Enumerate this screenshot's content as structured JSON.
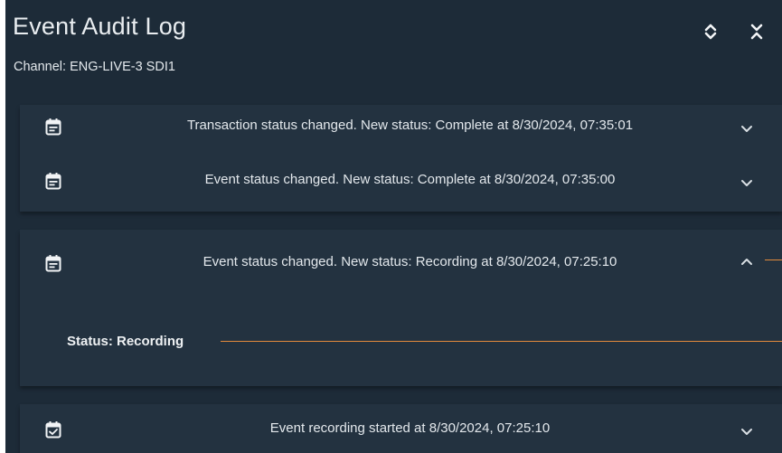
{
  "header": {
    "title": "Event Audit Log",
    "channel": "Channel: ENG-LIVE-3 SDI1",
    "expand_all_icon": "unfold-more-icon",
    "collapse_all_icon": "unfold-less-icon"
  },
  "entries": [
    {
      "icon": "calendar-text-icon",
      "text": "Transaction status changed. New status: Complete at 8/30/2024, 07:35:01",
      "expanded": false
    },
    {
      "icon": "calendar-text-icon",
      "text": "Event status changed. New status: Complete at 8/30/2024, 07:35:00",
      "expanded": false
    },
    {
      "icon": "calendar-text-icon",
      "text": "Event status changed. New status: Recording at 8/30/2024, 07:25:10",
      "expanded": true,
      "detail": "Status: Recording"
    },
    {
      "icon": "calendar-check-icon",
      "text": "Event recording started at 8/30/2024, 07:25:10",
      "expanded": false
    }
  ],
  "colors": {
    "panel_bg": "#1d2b38",
    "card_bg": "#233240",
    "text": "#e3e8ec",
    "accent_line": "#e38a3c"
  }
}
